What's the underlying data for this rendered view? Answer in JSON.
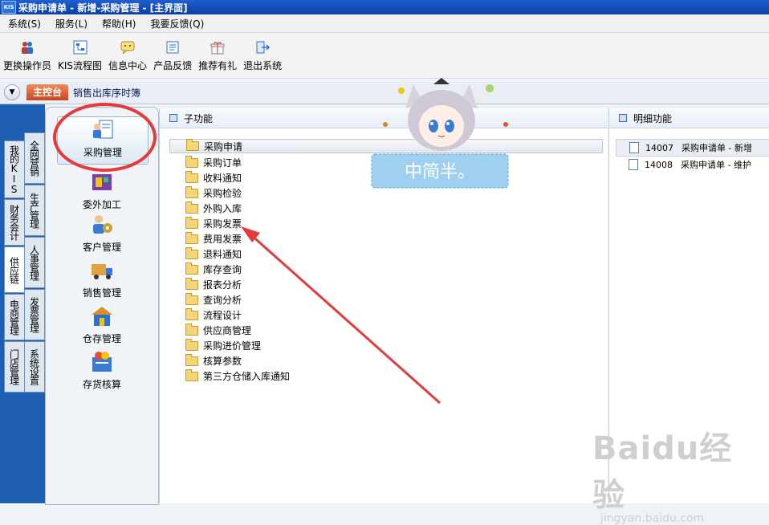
{
  "window": {
    "title": "采购申请单 - 新增-采购管理 - [主界面]",
    "app_icon": "KIS"
  },
  "menubar": [
    "系统(S)",
    "服务(L)",
    "帮助(H)",
    "我要反馈(Q)"
  ],
  "toolbar": [
    {
      "label": "更换操作员",
      "icon": "users-icon"
    },
    {
      "label": "KIS流程图",
      "icon": "flowchart-icon"
    },
    {
      "label": "信息中心",
      "icon": "chat-icon"
    },
    {
      "label": "产品反馈",
      "icon": "feedback-icon"
    },
    {
      "label": "推荐有礼",
      "icon": "gift-icon"
    },
    {
      "label": "退出系统",
      "icon": "exit-icon"
    }
  ],
  "tabs": {
    "main": "主控台",
    "second": "销售出库序时簿"
  },
  "vertical_tabs": {
    "outer": [
      "我的KIS",
      "财务会计",
      "供应链",
      "电商管理",
      "门店管理"
    ],
    "inner": [
      "全网营销",
      "生产管理",
      "人事管理",
      "发票管理",
      "系统设置"
    ]
  },
  "modules": [
    {
      "label": "采购管理",
      "icon": "purchase-icon",
      "selected": true
    },
    {
      "label": "委外加工",
      "icon": "outsource-icon"
    },
    {
      "label": "客户管理",
      "icon": "customer-icon"
    },
    {
      "label": "销售管理",
      "icon": "truck-icon"
    },
    {
      "label": "仓存管理",
      "icon": "warehouse-icon"
    },
    {
      "label": "存货核算",
      "icon": "inventory-icon"
    }
  ],
  "sub_panel": {
    "title": "子功能",
    "items": [
      "采购申请",
      "采购订单",
      "收料通知",
      "采购检验",
      "外购入库",
      "采购发票",
      "费用发票",
      "退料通知",
      "库存查询",
      "报表分析",
      "查询分析",
      "流程设计",
      "供应商管理",
      "采购进价管理",
      "核算参数",
      "第三方仓储入库通知"
    ]
  },
  "detail_panel": {
    "title": "明细功能",
    "items": [
      {
        "code": "14007",
        "label": "采购申请单 - 新增"
      },
      {
        "code": "14008",
        "label": "采购申请单 - 维护"
      }
    ]
  },
  "sticker_text": "中简半。",
  "watermark": {
    "brand": "Baidu经验",
    "url": "jingyan.baidu.com"
  },
  "colors": {
    "titlebar": "#0a3fa3",
    "highlight_red": "#e53a3a",
    "tab_main": "#d9572b"
  }
}
